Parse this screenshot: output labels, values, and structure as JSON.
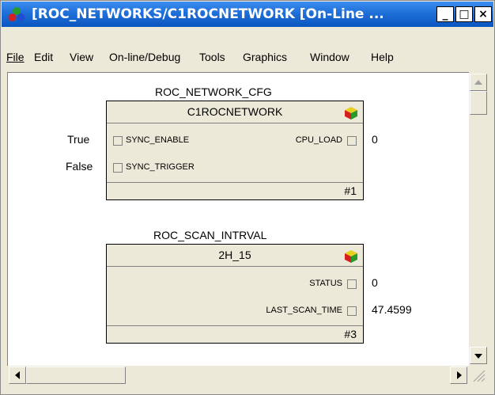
{
  "window": {
    "title": "[ROC_NETWORKS/C1ROCNETWORK [On-Line ...",
    "minimize_label": "_",
    "maximize_label": "□",
    "close_label": "×"
  },
  "menu": {
    "file": "File",
    "edit": "Edit",
    "view": "View",
    "online_debug": "On-line/Debug",
    "tools": "Tools",
    "graphics": "Graphics",
    "window": "Window",
    "help": "Help"
  },
  "blocks": [
    {
      "type_name": "ROC_NETWORK_CFG",
      "instance_name": "C1ROCNETWORK",
      "number": "#1",
      "input_values": [
        "True",
        "False"
      ],
      "inputs": [
        "SYNC_ENABLE",
        "SYNC_TRIGGER"
      ],
      "outputs": [
        "CPU_LOAD"
      ],
      "output_values": [
        "0"
      ]
    },
    {
      "type_name": "ROC_SCAN_INTRVAL",
      "instance_name": "2H_15",
      "number": "#3",
      "outputs": [
        "STATUS",
        "LAST_SCAN_TIME"
      ],
      "output_values": [
        "0",
        "47.4599"
      ]
    }
  ],
  "icons": {
    "app": "roc-network-app-icon",
    "block": "function-block-cube-icon"
  }
}
